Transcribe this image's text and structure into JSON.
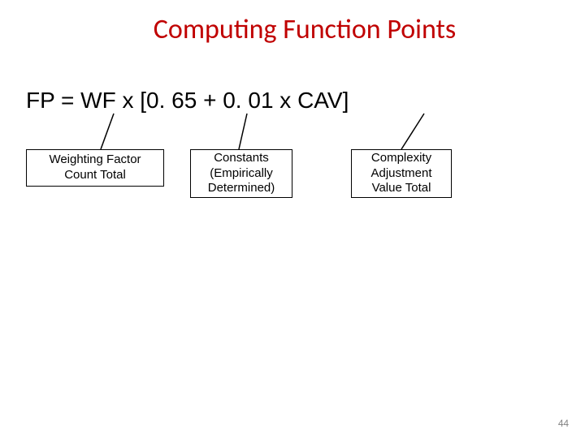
{
  "title": "Computing Function Points",
  "formula": "FP = WF x [0. 65 + 0. 01 x CAV]",
  "boxes": {
    "wf": "Weighting Factor Count Total",
    "constants": "Constants (Empirically Determined)",
    "cav": "Complexity Adjustment Value Total"
  },
  "page_number": "44"
}
